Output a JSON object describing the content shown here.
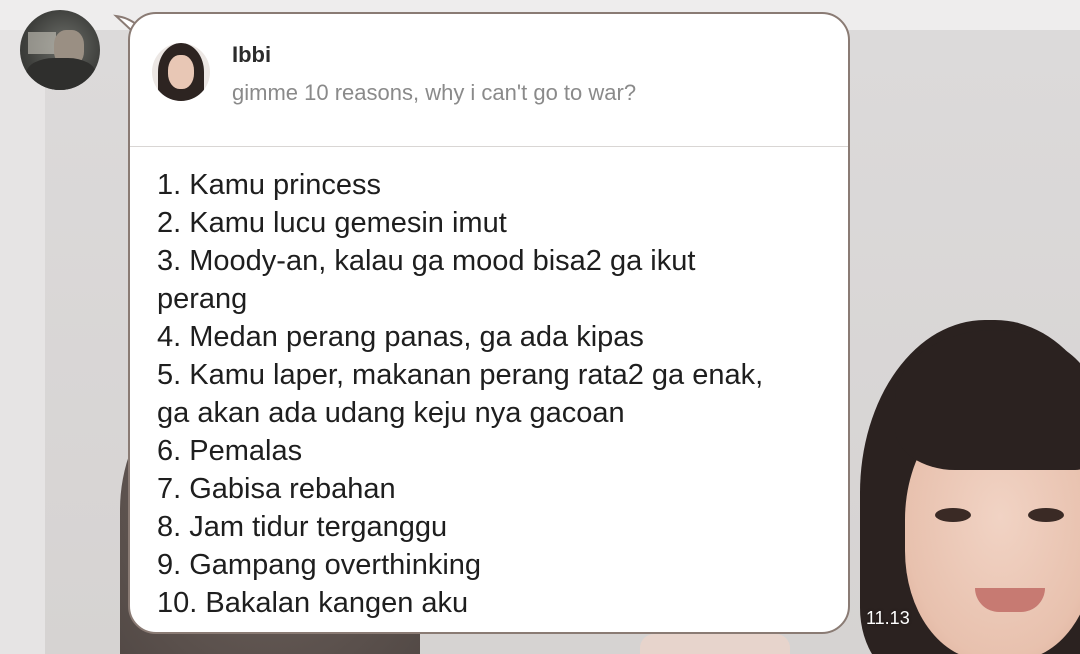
{
  "message": {
    "quoted": {
      "author": "Ibbi",
      "text": "gimme 10 reasons, why i can't go to war?"
    },
    "lines": [
      "1. Kamu princess",
      "2. Kamu lucu gemesin imut",
      "3. Moody-an, kalau ga mood bisa2 ga ikut",
      "perang",
      "4. Medan perang panas, ga ada kipas",
      "5. Kamu laper, makanan perang rata2 ga enak,",
      "ga akan ada udang keju nya gacoan",
      "6. Pemalas",
      "7. Gabisa rebahan",
      "8. Jam tidur terganggu",
      "9. Gampang overthinking",
      "10. Bakalan kangen aku"
    ],
    "time": "11.13"
  },
  "colors": {
    "bubble_border": "#8a7b74",
    "bubble_bg": "#ffffff",
    "quote_text": "#8a8a8a"
  },
  "icons": {
    "sender": "sender-avatar",
    "quoted": "quoted-avatar"
  }
}
